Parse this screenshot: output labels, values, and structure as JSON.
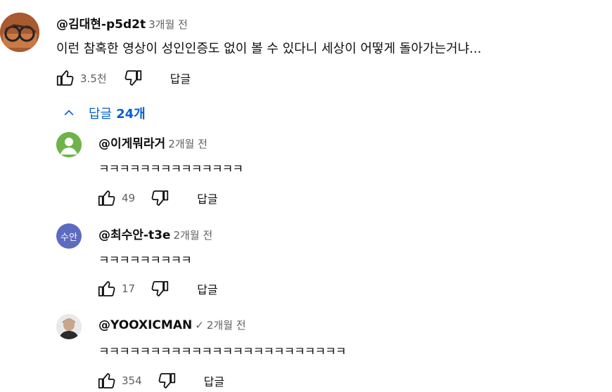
{
  "main_comment": {
    "author": "@김대현-p5d2t",
    "time": "3개월 전",
    "text": "이런 참혹한 영상이 성인인증도 없이 볼 수 있다니 세상이 어떻게 돌아가는거냐...",
    "likes": "3.5천",
    "reply_label": "답글"
  },
  "replies_toggle": {
    "label": "답글",
    "count": "24개"
  },
  "replies": [
    {
      "author": "@이게뭐라거",
      "time": "2개월 전",
      "text": "ㅋㅋㅋㅋㅋㅋㅋㅋㅋㅋㅋㅋㅋㅋ",
      "likes": "49",
      "reply_label": "답글"
    },
    {
      "author": "@최수안-t3e",
      "avatar_text": "수안",
      "time": "2개월 전",
      "text": "ㅋㅋㅋㅋㅋㅋㅋㅋㅋ",
      "likes": "17",
      "reply_label": "답글"
    },
    {
      "author": "@YOOXICMAN",
      "verified": "✓",
      "time": "2개월 전",
      "text": "ㅋㅋㅋㅋㅋㅋㅋㅋㅋㅋㅋㅋㅋㅋㅋㅋㅋㅋㅋㅋㅋㅋㅋㅋ",
      "likes": "354",
      "reply_label": "답글"
    }
  ],
  "colors": {
    "link_blue": "#065fd4",
    "secondary_text": "#606060",
    "avatar_green": "#4caf50",
    "avatar_indigo": "#5c6bc0"
  }
}
